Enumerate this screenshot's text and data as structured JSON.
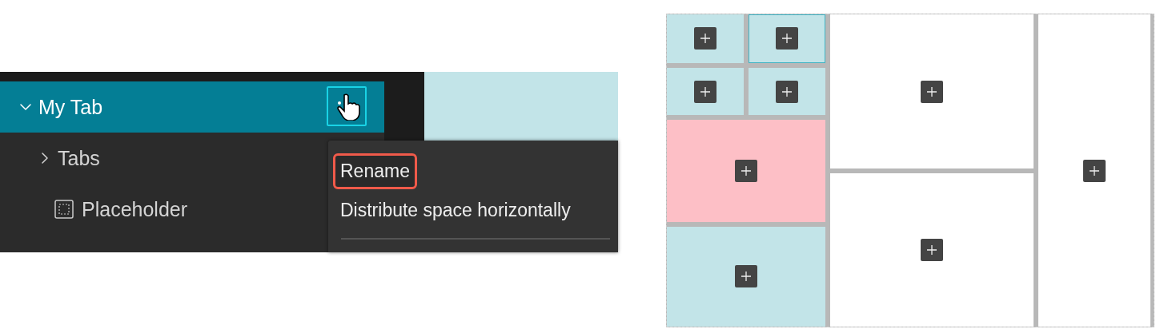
{
  "tree": [
    {
      "label": "My Tab",
      "kind": "folder",
      "expanded": true,
      "selected": true,
      "children": [
        {
          "label": "Tabs",
          "kind": "folder",
          "expanded": false,
          "selected": false
        },
        {
          "label": "Placeholder",
          "kind": "placeholder",
          "selected": false
        }
      ]
    }
  ],
  "context_menu": {
    "items": [
      {
        "label": "Rename",
        "highlighted": true
      },
      {
        "label": "Distribute space horizontally",
        "highlighted": false
      }
    ]
  },
  "layout_grid": {
    "columns": [
      {
        "rows": [
          {
            "cells": [
              {
                "color": "#c2e4e8",
                "selected": false
              },
              {
                "color": "#c2e4e8",
                "selected": true
              }
            ]
          },
          {
            "cells": [
              {
                "color": "#c2e4e8",
                "selected": false
              },
              {
                "color": "#c2e4e8",
                "selected": false
              }
            ]
          },
          {
            "cells": [
              {
                "color": "#fdbfc6",
                "selected": false
              }
            ]
          },
          {
            "cells": [
              {
                "color": "#c2e4e8",
                "selected": false
              }
            ]
          }
        ]
      },
      {
        "rows": [
          {
            "cells": [
              {
                "color": "#ffffff",
                "selected": false
              }
            ]
          },
          {
            "cells": [
              {
                "color": "#ffffff",
                "selected": false
              }
            ]
          }
        ]
      },
      {
        "rows": [
          {
            "cells": [
              {
                "color": "#ffffff",
                "selected": false
              }
            ]
          }
        ]
      }
    ]
  }
}
